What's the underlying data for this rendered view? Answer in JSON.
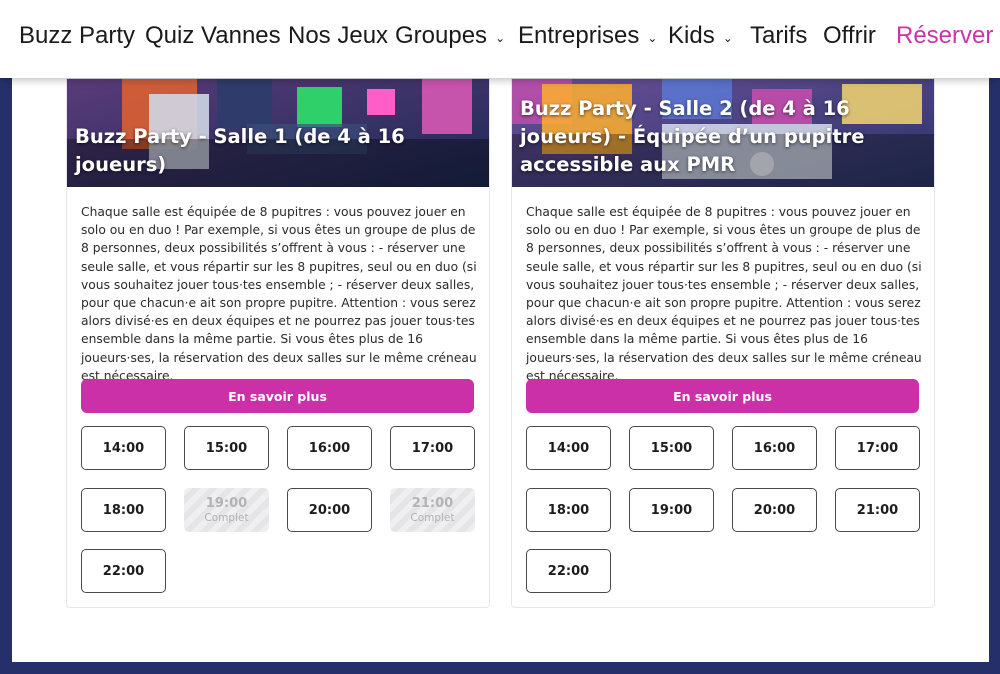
{
  "nav": {
    "items": [
      {
        "label": "Buzz Party"
      },
      {
        "label": "Quiz Vannes"
      },
      {
        "label": "Nos Jeux"
      },
      {
        "label": "Groupes"
      },
      {
        "label": "Entreprises"
      },
      {
        "label": "Kids"
      },
      {
        "label": "Tarifs"
      },
      {
        "label": "Offrir"
      },
      {
        "label": "Réserver"
      }
    ],
    "dropdown_icon": "chevron-down-icon",
    "accent_color": "#cc33aa"
  },
  "rooms": [
    {
      "title": "Buzz Party - Salle 1 (de 4 à 16 joueurs)",
      "description": "Chaque salle est équipée de 8 pupitres : vous pouvez jouer en solo ou en duo ! Par exemple, si vous êtes un groupe de plus de 8 personnes, deux possibilités s’offrent à vous : - réserver une seule salle, et vous répartir sur les 8 pupitres, seul ou en duo (si vous souhaitez jouer tous·tes ensemble ; - réserver deux salles, pour que chacun·e ait son propre pupitre. Attention : vous serez alors divisé·es en deux équipes et ne pourrez pas jouer tous·tes ensemble dans la même partie. Si vous êtes plus de 16 joueurs·ses, la réservation des deux salles sur le même créneau est nécessaire.",
      "cta": "En savoir plus",
      "slots": [
        {
          "time": "14:00",
          "status": ""
        },
        {
          "time": "15:00",
          "status": ""
        },
        {
          "time": "16:00",
          "status": ""
        },
        {
          "time": "17:00",
          "status": ""
        },
        {
          "time": "18:00",
          "status": ""
        },
        {
          "time": "19:00",
          "status": "Complet"
        },
        {
          "time": "20:00",
          "status": ""
        },
        {
          "time": "21:00",
          "status": "Complet"
        },
        {
          "time": "22:00",
          "status": ""
        }
      ]
    },
    {
      "title": "Buzz Party - Salle 2 (de 4 à 16 joueurs) - Équipée d’un pupitre accessible aux PMR",
      "description": "Chaque salle est équipée de 8 pupitres : vous pouvez jouer en solo ou en duo ! Par exemple, si vous êtes un groupe de plus de 8 personnes, deux possibilités s’offrent à vous : - réserver une seule salle, et vous répartir sur les 8 pupitres, seul ou en duo (si vous souhaitez jouer tous·tes ensemble ; - réserver deux salles, pour que chacun·e ait son propre pupitre. Attention : vous serez alors divisé·es en deux équipes et ne pourrez pas jouer tous·tes ensemble dans la même partie. Si vous êtes plus de 16 joueurs·ses, la réservation des deux salles sur le même créneau est nécessaire.",
      "cta": "En savoir plus",
      "slots": [
        {
          "time": "14:00",
          "status": ""
        },
        {
          "time": "15:00",
          "status": ""
        },
        {
          "time": "16:00",
          "status": ""
        },
        {
          "time": "17:00",
          "status": ""
        },
        {
          "time": "18:00",
          "status": ""
        },
        {
          "time": "19:00",
          "status": ""
        },
        {
          "time": "20:00",
          "status": ""
        },
        {
          "time": "21:00",
          "status": ""
        },
        {
          "time": "22:00",
          "status": ""
        }
      ]
    }
  ],
  "colors": {
    "page_background": "#25306a",
    "button": "#cc30a8"
  }
}
